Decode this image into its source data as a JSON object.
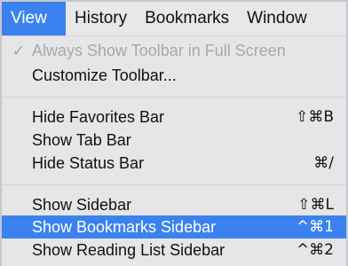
{
  "menubar": {
    "items": [
      {
        "label": "View"
      },
      {
        "label": "History"
      },
      {
        "label": "Bookmarks"
      },
      {
        "label": "Window"
      }
    ]
  },
  "menu": {
    "always_show_toolbar": {
      "label": "Always Show Toolbar in Full Screen",
      "check": "✓"
    },
    "customize_toolbar": {
      "label": "Customize Toolbar..."
    },
    "hide_favorites_bar": {
      "label": "Hide Favorites Bar",
      "shortcut": "⇧⌘B"
    },
    "show_tab_bar": {
      "label": "Show Tab Bar"
    },
    "hide_status_bar": {
      "label": "Hide Status Bar",
      "shortcut": "⌘/"
    },
    "show_sidebar": {
      "label": "Show Sidebar",
      "shortcut": "⇧⌘L"
    },
    "show_bookmarks_sidebar": {
      "label": "Show Bookmarks Sidebar",
      "shortcut": "^⌘1"
    },
    "show_reading_list_sidebar": {
      "label": "Show Reading List Sidebar",
      "shortcut": "^⌘2"
    }
  },
  "colors": {
    "highlight": "#3b82f0",
    "menu_background": "#e6e6e9",
    "disabled_text": "#a8a8ac"
  }
}
